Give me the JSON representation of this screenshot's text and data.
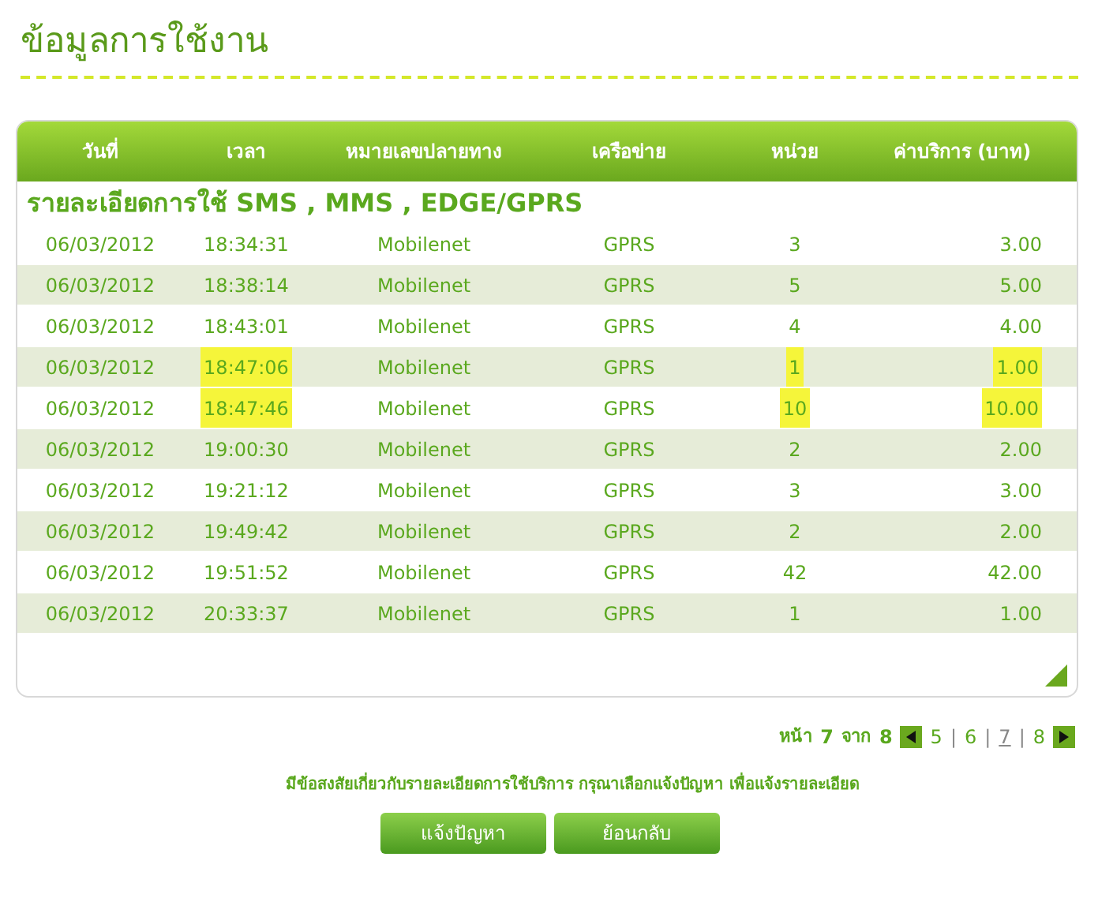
{
  "page_title": "ข้อมูลการใช้งาน",
  "table": {
    "columns": [
      "วันที่",
      "เวลา",
      "หมายเลขปลายทาง",
      "เครือข่าย",
      "หน่วย",
      "ค่าบริการ (บาท)"
    ],
    "section_title": "รายละเอียดการใช้ SMS , MMS , EDGE/GPRS",
    "rows": [
      {
        "cells": [
          "06/03/2012",
          "18:34:31",
          "Mobilenet",
          "GPRS",
          "3",
          "3.00"
        ],
        "highlighted": false
      },
      {
        "cells": [
          "06/03/2012",
          "18:38:14",
          "Mobilenet",
          "GPRS",
          "5",
          "5.00"
        ],
        "highlighted": false
      },
      {
        "cells": [
          "06/03/2012",
          "18:43:01",
          "Mobilenet",
          "GPRS",
          "4",
          "4.00"
        ],
        "highlighted": false
      },
      {
        "cells": [
          "06/03/2012",
          "18:47:06",
          "Mobilenet",
          "GPRS",
          "1",
          "1.00"
        ],
        "highlighted": true
      },
      {
        "cells": [
          "06/03/2012",
          "18:47:46",
          "Mobilenet",
          "GPRS",
          "10",
          "10.00"
        ],
        "highlighted": true
      },
      {
        "cells": [
          "06/03/2012",
          "19:00:30",
          "Mobilenet",
          "GPRS",
          "2",
          "2.00"
        ],
        "highlighted": false
      },
      {
        "cells": [
          "06/03/2012",
          "19:21:12",
          "Mobilenet",
          "GPRS",
          "3",
          "3.00"
        ],
        "highlighted": false
      },
      {
        "cells": [
          "06/03/2012",
          "19:49:42",
          "Mobilenet",
          "GPRS",
          "2",
          "2.00"
        ],
        "highlighted": false
      },
      {
        "cells": [
          "06/03/2012",
          "19:51:52",
          "Mobilenet",
          "GPRS",
          "42",
          "42.00"
        ],
        "highlighted": false
      },
      {
        "cells": [
          "06/03/2012",
          "20:33:37",
          "Mobilenet",
          "GPRS",
          "1",
          "1.00"
        ],
        "highlighted": false
      }
    ]
  },
  "pagination": {
    "page_label": "หน้า",
    "current": "7",
    "of_label": "จาก",
    "total": "8",
    "separator": "|",
    "pages": [
      {
        "label": "5",
        "selected": false
      },
      {
        "label": "6",
        "selected": false
      },
      {
        "label": "7",
        "selected": true
      },
      {
        "label": "8",
        "selected": false
      }
    ]
  },
  "note": "มีข้อสงสัยเกี่ยวกับรายละเอียดการใช้บริการ กรุณาเลือกแจ้งปัญหา เพื่อแจ้งรายละเอียด",
  "buttons": [
    "แจ้งปัญหา",
    "ย้อนกลับ"
  ]
}
